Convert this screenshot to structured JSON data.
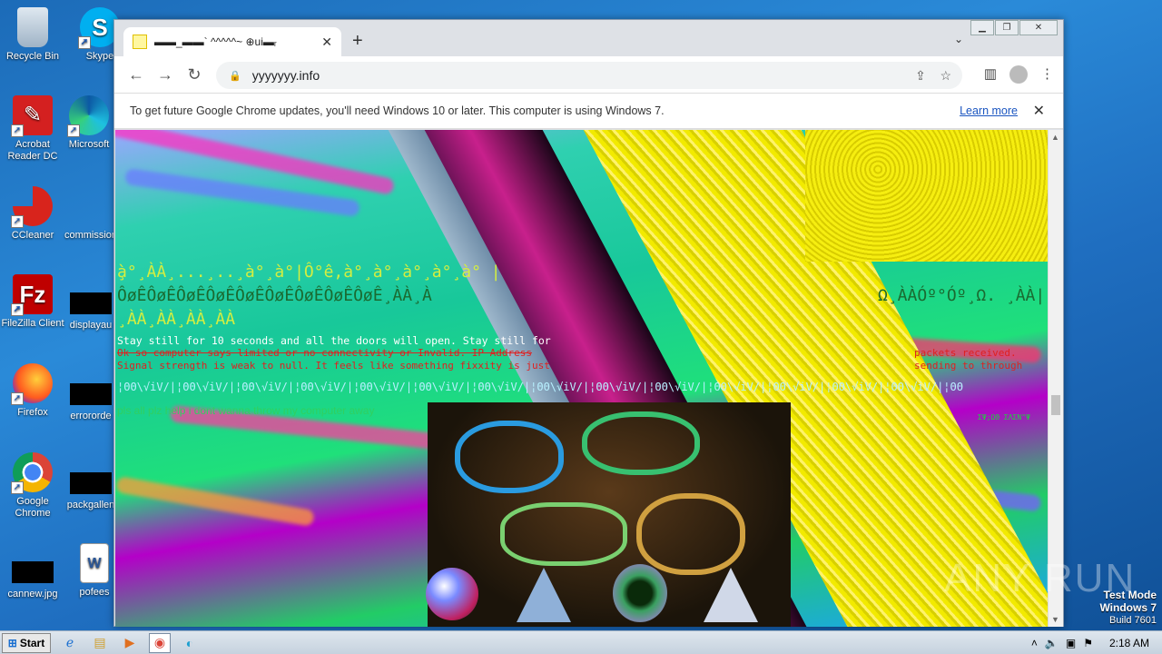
{
  "desktop": {
    "icons": [
      {
        "label": "Recycle Bin"
      },
      {
        "label": "Skype"
      },
      {
        "label": "Acrobat Reader DC"
      },
      {
        "label": "Microsoft"
      },
      {
        "label": "CCleaner"
      },
      {
        "label": "commission"
      },
      {
        "label": "FileZilla Client"
      },
      {
        "label": "displayau"
      },
      {
        "label": "Firefox"
      },
      {
        "label": "errororde"
      },
      {
        "label": "Google Chrome"
      },
      {
        "label": "packgallen"
      },
      {
        "label": "cannew.jpg"
      },
      {
        "label": "pofees"
      }
    ]
  },
  "browser": {
    "tab_title": "▬▬_▬▬` ^^^^^~ ⊕ui▬ᵣ",
    "url": "yyyyyyy.info",
    "infobar_text": "To get future Google Chrome updates, you'll need Windows 10 or later. This computer is using Windows 7.",
    "infobar_link": "Learn more"
  },
  "page": {
    "line1": "̧à°¸ÀÀ¸...¸..¸à°¸à°|Ô°ê,à°¸à°¸à°¸à°¸à° |",
    "line2": "ÔøÊÔøÊÔøÊÔøÊÔøÊÔøÊÔøÊÔøÊÔøÊ¸ÀÀ¸À",
    "line3": "¸ÀÀ¸ÀÀ¸ÀÀ¸ÀÀ",
    "line2_right": "Ω¸ÀÀÓº°Óº¸Ω. ¸ÀÀ|",
    "stay_still": "Stay still for 10 seconds and all the doors will open. Stay still for",
    "red1": "Ok so computer says limited or no connectivity or Invalid. IP Address",
    "red1_right": "packets received.",
    "red2": "Signal strength is weak to null. It feels like something fixxity is just",
    "red2_right": "sending to through",
    "repeat": "¦ΘΘ\\√iV/|¦ΘΘ\\√iV/|¦ΘΘ\\√iV/|¦ΘΘ\\√iV/|¦ΘΘ\\√iV/|¦ΘΘ\\√iV/|¦ΘΘ\\√iV/|¦ΘΘ\\√iV/|¦ΘΘ\\√iV/|¦ΘΘ\\√iV/|¦ΘΘ\\√iV/|¦ΘΘ\\√iV/|¦ΘΘ\\√iV/|¦ΘΘ\\√iV/|¦ΘΘ",
    "plea": "pls all plz help i dont wanna throw my computer away",
    "side_small": "ΣΨ;ΩΘ ΣΛΣΝ\"Ψ"
  },
  "taskbar": {
    "start_label": "Start",
    "clock": "2:18 AM"
  },
  "watermark": {
    "line1": "Test Mode",
    "line2": "Windows 7",
    "line3": "Build 7601",
    "brand": "ANY RUN"
  },
  "colors": {
    "accent": "#1a55c0",
    "glitch_yellow": "#f0e800",
    "glitch_red": "#e02020"
  }
}
